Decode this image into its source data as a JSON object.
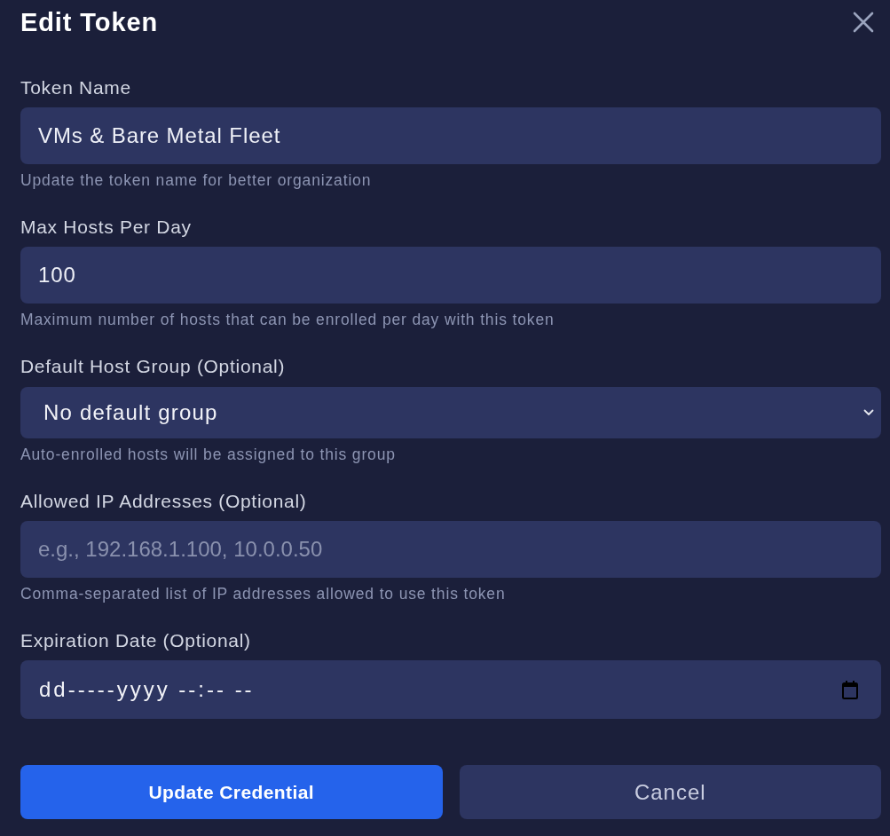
{
  "dialog": {
    "title": "Edit Token"
  },
  "fields": [
    {
      "kind": "text",
      "label": "Token Name",
      "value": "VMs & Bare Metal Fleet",
      "help_text": "Update the token name for better organization"
    },
    {
      "kind": "text",
      "label": "Max Hosts Per Day",
      "value": "100",
      "help_text": "Maximum number of hosts that can be enrolled per day with this token"
    },
    {
      "kind": "select",
      "label": "Default Host Group (Optional)",
      "value": "No default group",
      "help_text": "Auto-enrolled hosts will be assigned to this group"
    },
    {
      "kind": "text",
      "label": "Allowed IP Addresses (Optional)",
      "placeholder": "e.g., 192.168.1.100, 10.0.0.50",
      "help_text": "Comma-separated list of IP addresses allowed to use this token"
    },
    {
      "kind": "datetime",
      "label": "Expiration Date (Optional)",
      "value": "dd-----yyyy --:-- --"
    }
  ],
  "buttons": [
    {
      "kind": "primary",
      "label": "Update Credential"
    },
    {
      "kind": "secondary",
      "label": "Cancel"
    }
  ]
}
